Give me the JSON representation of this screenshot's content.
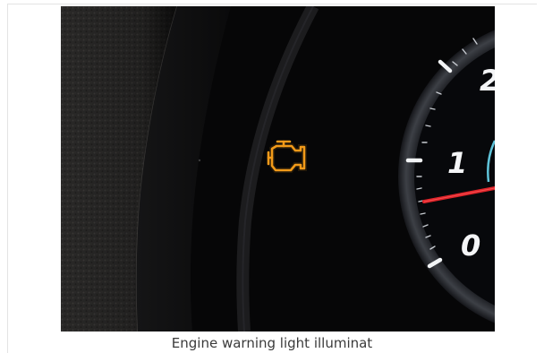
{
  "figure": {
    "caption": "Engine warning light illuminat",
    "gauge_numbers": [
      "2",
      "1",
      "0"
    ]
  },
  "icons": {
    "warning_icon": "check-engine-icon",
    "warning_color": "#f29a1a",
    "needle_color": "#e0242a",
    "accent_color": "#5fc3d9"
  }
}
